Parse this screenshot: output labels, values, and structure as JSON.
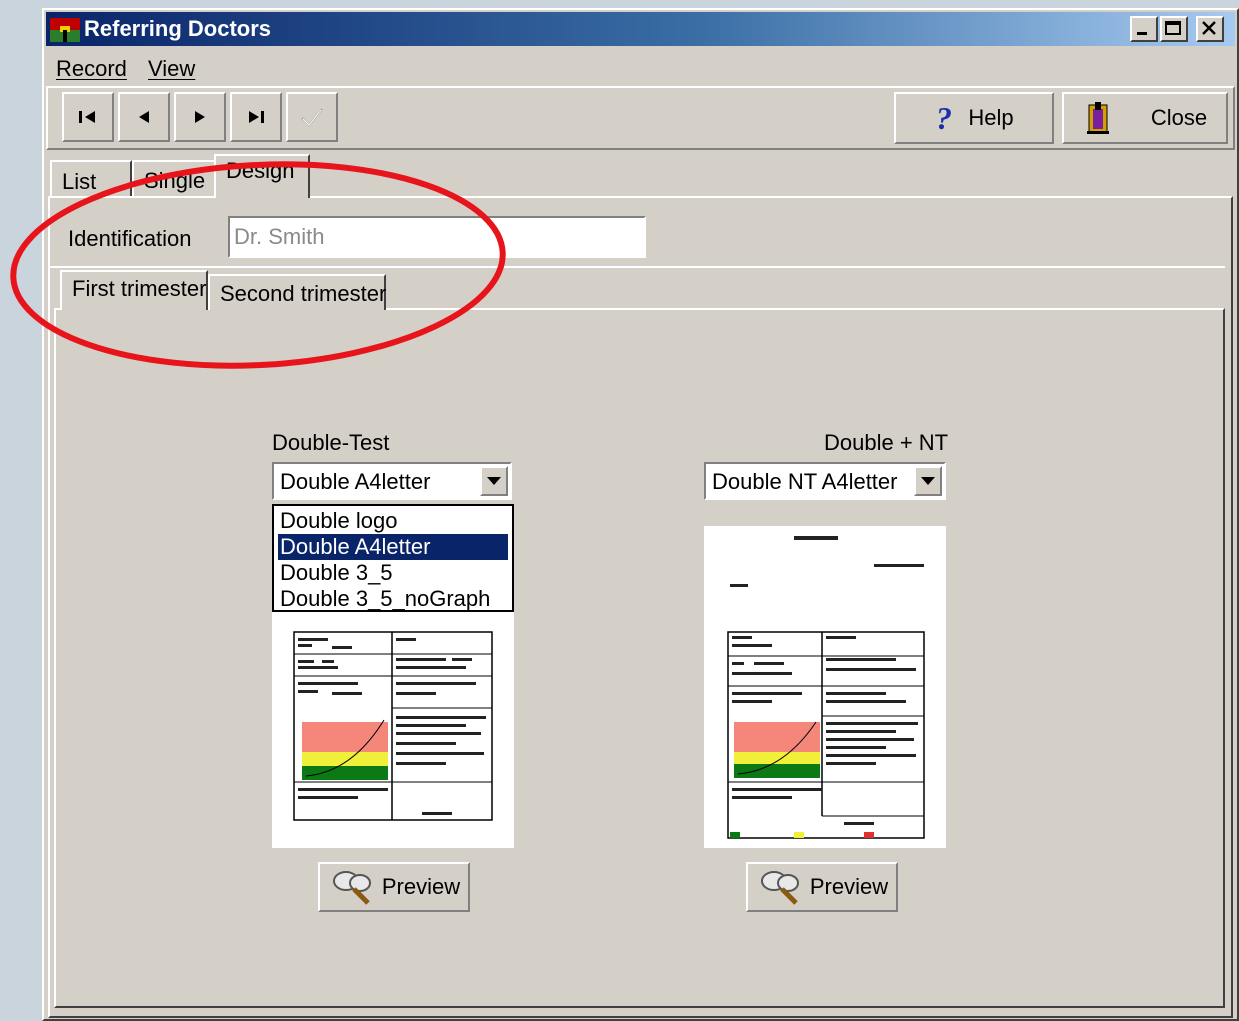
{
  "window": {
    "title": "Referring Doctors"
  },
  "menu": [
    {
      "label": "Record"
    },
    {
      "label": "View"
    }
  ],
  "toolbar": {
    "help_label": "Help",
    "close_label": "Close"
  },
  "tabs": {
    "list": "List",
    "single": "Single",
    "design": "Design"
  },
  "identification": {
    "label": "Identification",
    "value": "Dr. Smith"
  },
  "subtabs": {
    "first": "First trimester",
    "second": "Second trimester"
  },
  "double_test": {
    "label": "Double-Test",
    "selected": "Double A4letter",
    "options": [
      "Double logo",
      "Double A4letter",
      "Double 3_5",
      "Double 3_5_noGraph"
    ],
    "preview_label": "Preview"
  },
  "double_nt": {
    "label": "Double + NT",
    "selected": "Double NT A4letter",
    "preview_label": "Preview"
  },
  "colors": {
    "titlebar": "#0a246a",
    "annotation": "#e8141c",
    "chart_red": "#f4867a",
    "chart_yellow": "#f0ef3a",
    "chart_green": "#0b7a14"
  }
}
